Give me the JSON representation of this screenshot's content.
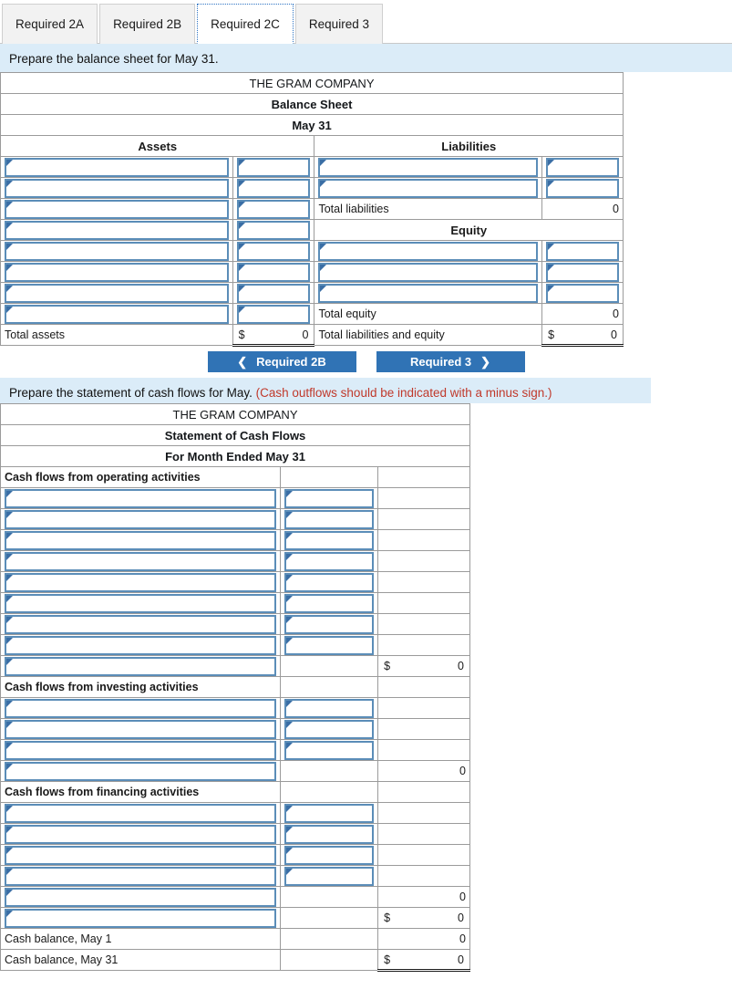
{
  "tabs": [
    {
      "label": "Required 2A",
      "active": false
    },
    {
      "label": "Required 2B",
      "active": false
    },
    {
      "label": "Required 2C",
      "active": true
    },
    {
      "label": "Required 3",
      "active": false
    }
  ],
  "balance_section": {
    "instruction": "Prepare the balance sheet for May 31.",
    "company": "THE GRAM COMPANY",
    "statement": "Balance Sheet",
    "period": "May 31",
    "assets_heading": "Assets",
    "liabilities_heading": "Liabilities",
    "equity_heading": "Equity",
    "assets_rows": 8,
    "liability_rows": 2,
    "equity_rows": 3,
    "total_assets_label": "Total assets",
    "total_assets_symbol": "$",
    "total_assets_value": "0",
    "total_liabilities_label": "Total liabilities",
    "total_liabilities_value": "0",
    "total_equity_label": "Total equity",
    "total_equity_value": "0",
    "total_liab_equity_label": "Total liabilities and equity",
    "total_liab_equity_symbol": "$",
    "total_liab_equity_value": "0"
  },
  "nav": {
    "prev_label": "Required 2B",
    "next_label": "Required 3",
    "prev_icon": "chevron-left-icon",
    "next_icon": "chevron-right-icon",
    "prev_chevron": "❮",
    "next_chevron": "❯"
  },
  "cashflow_section": {
    "instruction_main": "Prepare the statement of cash flows for May.",
    "instruction_note": "(Cash outflows should be indicated with a minus sign.)",
    "company": "THE GRAM COMPANY",
    "statement": "Statement of Cash Flows",
    "period": "For Month Ended May 31",
    "operating_heading": "Cash flows from operating activities",
    "operating_rows": 8,
    "operating_total_symbol": "$",
    "operating_total_value": "0",
    "investing_heading": "Cash flows from investing activities",
    "investing_rows": 3,
    "investing_total_value": "0",
    "financing_heading": "Cash flows from financing activities",
    "financing_rows": 4,
    "financing_total_value": "0",
    "net_change_symbol": "$",
    "net_change_value": "0",
    "cash_begin_label": "Cash balance, May 1",
    "cash_begin_value": "0",
    "cash_end_label": "Cash balance, May 31",
    "cash_end_symbol": "$",
    "cash_end_value": "0"
  },
  "colors": {
    "header_blue": "#77abe5",
    "instruction_blue": "#dbecf8",
    "button_blue": "#3073b5",
    "input_border": "#5b8db8",
    "note_red": "#c0392b"
  }
}
